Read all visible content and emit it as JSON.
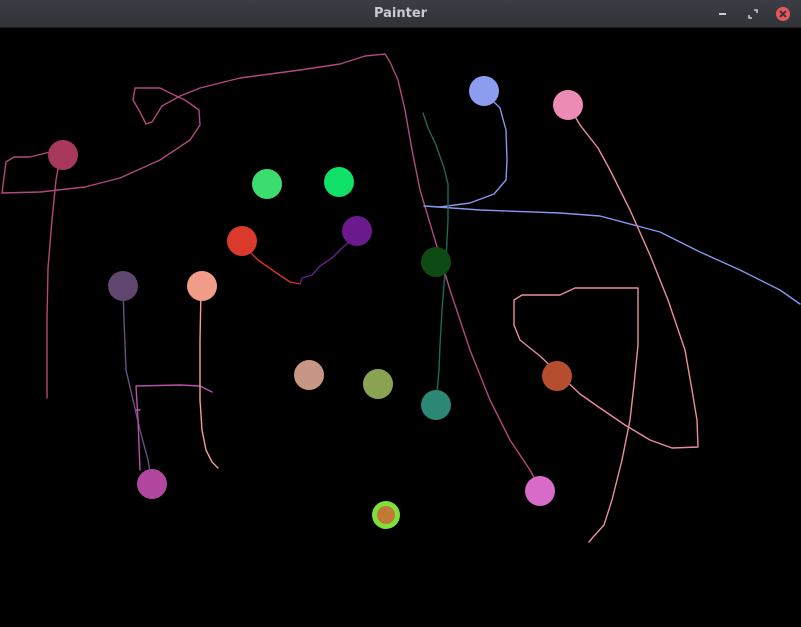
{
  "window": {
    "title": "Painter",
    "buttons": [
      "minimize",
      "maximize",
      "close"
    ]
  },
  "colors": {
    "titlebar": "#35383e",
    "canvas": "#000000",
    "close_button": "#e8575a",
    "selected_ring": "#7ee03a"
  },
  "icons": {
    "minimize": "minimize-icon",
    "maximize": "maximize-icon",
    "close": "close-icon"
  },
  "palette_dots": [
    {
      "name": "crimson",
      "color": "#a8375c"
    },
    {
      "name": "green",
      "color": "#3ddc6e"
    },
    {
      "name": "bright-green",
      "color": "#0fe068"
    },
    {
      "name": "red",
      "color": "#d93a2c"
    },
    {
      "name": "purple",
      "color": "#6b1a8e"
    },
    {
      "name": "periwinkle",
      "color": "#8c9df0"
    },
    {
      "name": "pink",
      "color": "#ee8bb5"
    },
    {
      "name": "dark-green",
      "color": "#0d4a14"
    },
    {
      "name": "dusty-purple",
      "color": "#5e466e"
    },
    {
      "name": "salmon",
      "color": "#f09c88"
    },
    {
      "name": "tan",
      "color": "#c89684"
    },
    {
      "name": "olive",
      "color": "#8aa352"
    },
    {
      "name": "teal",
      "color": "#2c8774"
    },
    {
      "name": "rust",
      "color": "#b54d2f"
    },
    {
      "name": "magenta",
      "color": "#b0469e"
    },
    {
      "name": "orchid",
      "color": "#d86bc8"
    },
    {
      "name": "orange-selected",
      "color": "#c07a36",
      "selected": true
    }
  ],
  "strokes": [
    {
      "name": "crimson-loop",
      "color": "#b04a7e"
    },
    {
      "name": "crimson-drop",
      "color": "#b8476a"
    },
    {
      "name": "red-purple-link",
      "color": "#d7312a"
    },
    {
      "name": "purple-link",
      "color": "#6a1d8c"
    },
    {
      "name": "periwinkle-line",
      "color": "#8797ee"
    },
    {
      "name": "pink-loop",
      "color": "#e88f9c"
    },
    {
      "name": "pink-rust-loop",
      "color": "#e4938e"
    },
    {
      "name": "teal-line",
      "color": "#1f6a52"
    },
    {
      "name": "orchid-line",
      "color": "#d468c7"
    },
    {
      "name": "dusty-purple-line",
      "color": "#6a4e84"
    },
    {
      "name": "salmon-line",
      "color": "#f4a08c"
    },
    {
      "name": "magenta-h",
      "color": "#b552a8"
    }
  ]
}
